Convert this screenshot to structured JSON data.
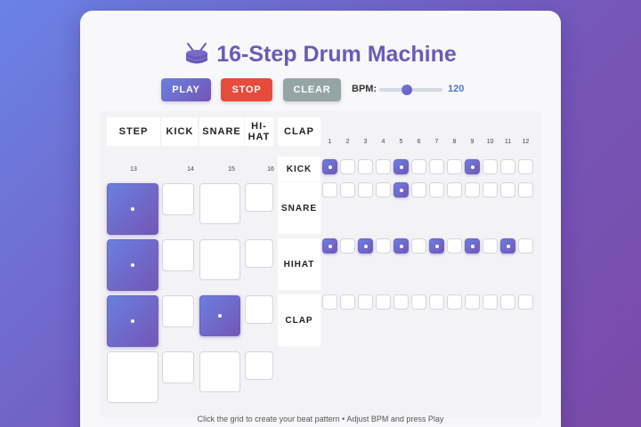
{
  "title": "16-Step Drum Machine",
  "title_icon": "drum-icon",
  "controls": {
    "play": "PLAY",
    "stop": "STOP",
    "clear": "CLEAR",
    "bpm_label": "BPM:",
    "bpm_value": "120",
    "bpm": 120
  },
  "headers": {
    "step": "STEP",
    "kick": "KICK",
    "snare": "SNARE",
    "hihat": "HI-HAT",
    "clap": "CLAP"
  },
  "step_numbers": [
    "1",
    "2",
    "3",
    "4",
    "5",
    "6",
    "7",
    "8",
    "9",
    "10",
    "11",
    "12"
  ],
  "wrap_step_numbers": [
    "13",
    "14",
    "15",
    "16"
  ],
  "rows": [
    {
      "label": "KICK",
      "steps": [
        1,
        0,
        0,
        0,
        1,
        0,
        0,
        0,
        1,
        0,
        0,
        0
      ]
    },
    {
      "label": "SNARE",
      "steps": [
        0,
        0,
        0,
        0,
        1,
        0,
        0,
        0,
        0,
        0,
        0,
        0
      ]
    },
    {
      "label": "HIHAT",
      "steps": [
        1,
        0,
        1,
        0,
        1,
        0,
        1,
        0,
        1,
        0,
        1,
        0
      ]
    },
    {
      "label": "CLAP",
      "steps": [
        0,
        0,
        0,
        0,
        0,
        0,
        0,
        0,
        0,
        0,
        0,
        0
      ]
    }
  ],
  "wrap_cells": [
    [
      1,
      0,
      0,
      0
    ],
    [
      1,
      0,
      0,
      0
    ],
    [
      1,
      0,
      1,
      0
    ],
    [
      0,
      0,
      0,
      0
    ]
  ],
  "footer": "Click the grid to create your beat pattern • Adjust BPM and press Play",
  "colors": {
    "accent": "#6a5ab8",
    "stop": "#e64b3c",
    "clear": "#95a5a6",
    "bpm": "#4b78c8"
  }
}
